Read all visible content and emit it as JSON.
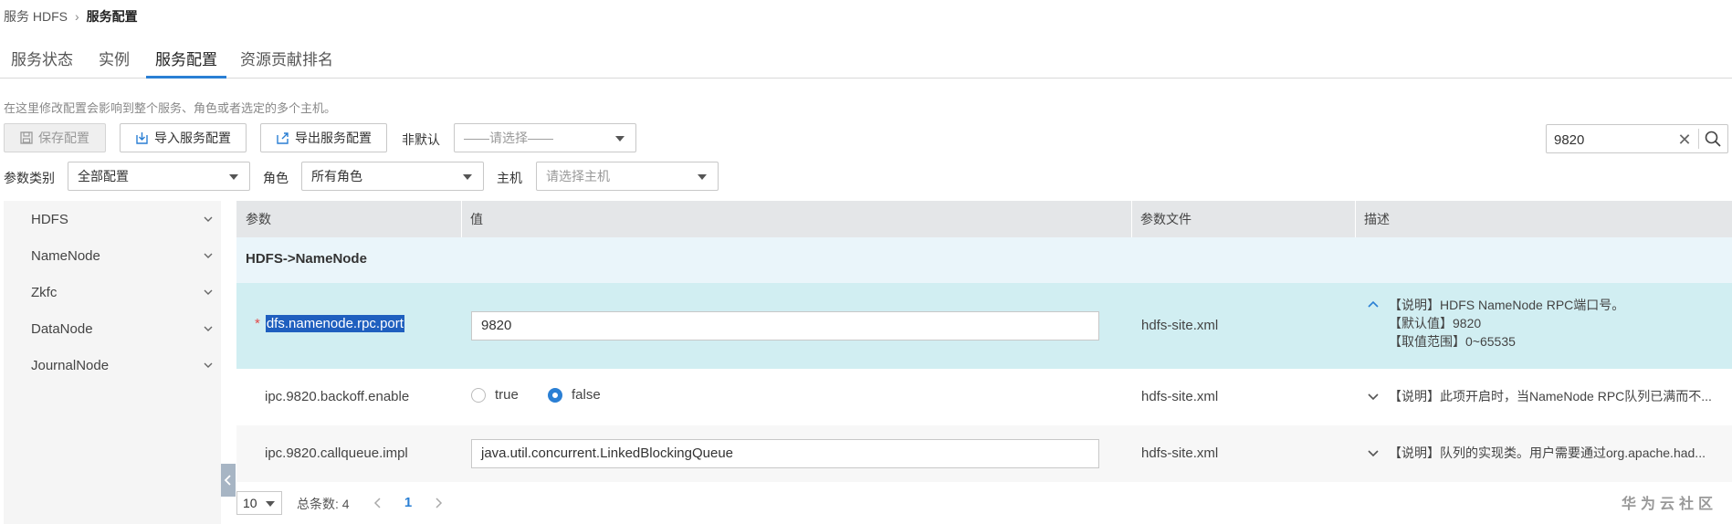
{
  "breadcrumb": {
    "parent": "服务 HDFS",
    "separator": "›",
    "current": "服务配置"
  },
  "tabs": [
    {
      "label": "服务状态",
      "active": false
    },
    {
      "label": "实例",
      "active": false
    },
    {
      "label": "服务配置",
      "active": true
    },
    {
      "label": "资源贡献排名",
      "active": false
    }
  ],
  "hint": "在这里修改配置会影响到整个服务、角色或者选定的多个主机。",
  "toolbar": {
    "save_label": "保存配置",
    "import_label": "导入服务配置",
    "export_label": "导出服务配置",
    "nondefault_label": "非默认",
    "nondefault_placeholder": "——请选择——"
  },
  "search": {
    "value": "9820"
  },
  "filters": {
    "category_label": "参数类别",
    "category_value": "全部配置",
    "role_label": "角色",
    "role_value": "所有角色",
    "host_label": "主机",
    "host_placeholder": "请选择主机"
  },
  "sidebar": {
    "items": [
      {
        "label": "HDFS"
      },
      {
        "label": "NameNode"
      },
      {
        "label": "Zkfc"
      },
      {
        "label": "DataNode"
      },
      {
        "label": "JournalNode"
      }
    ]
  },
  "table": {
    "headers": {
      "param": "参数",
      "value": "值",
      "file": "参数文件",
      "desc": "描述"
    },
    "group": "HDFS->NameNode",
    "rows": [
      {
        "name": "dfs.namenode.rpc.port",
        "required": "*",
        "value": "9820",
        "file": "hdfs-site.xml",
        "desc_lines": [
          "【说明】HDFS NameNode RPC端口号。",
          "【默认值】9820",
          "【取值范围】0~65535"
        ]
      },
      {
        "name": "ipc.9820.backoff.enable",
        "options": [
          "true",
          "false"
        ],
        "selected": "false",
        "file": "hdfs-site.xml",
        "desc": "【说明】此项开启时，当NameNode RPC队列已满而不..."
      },
      {
        "name": "ipc.9820.callqueue.impl",
        "value": "java.util.concurrent.LinkedBlockingQueue",
        "file": "hdfs-site.xml",
        "desc": "【说明】队列的实现类。用户需要通过org.apache.had..."
      }
    ]
  },
  "pagination": {
    "page_size": "10",
    "total_label": "总条数: 4",
    "current_page": "1"
  },
  "watermark": "华为云社区",
  "colors": {
    "accent": "#2a7fd4",
    "selected_row": "#d1eef2",
    "group_row": "#eaf5fa",
    "header_bg": "#e4e6e8"
  }
}
